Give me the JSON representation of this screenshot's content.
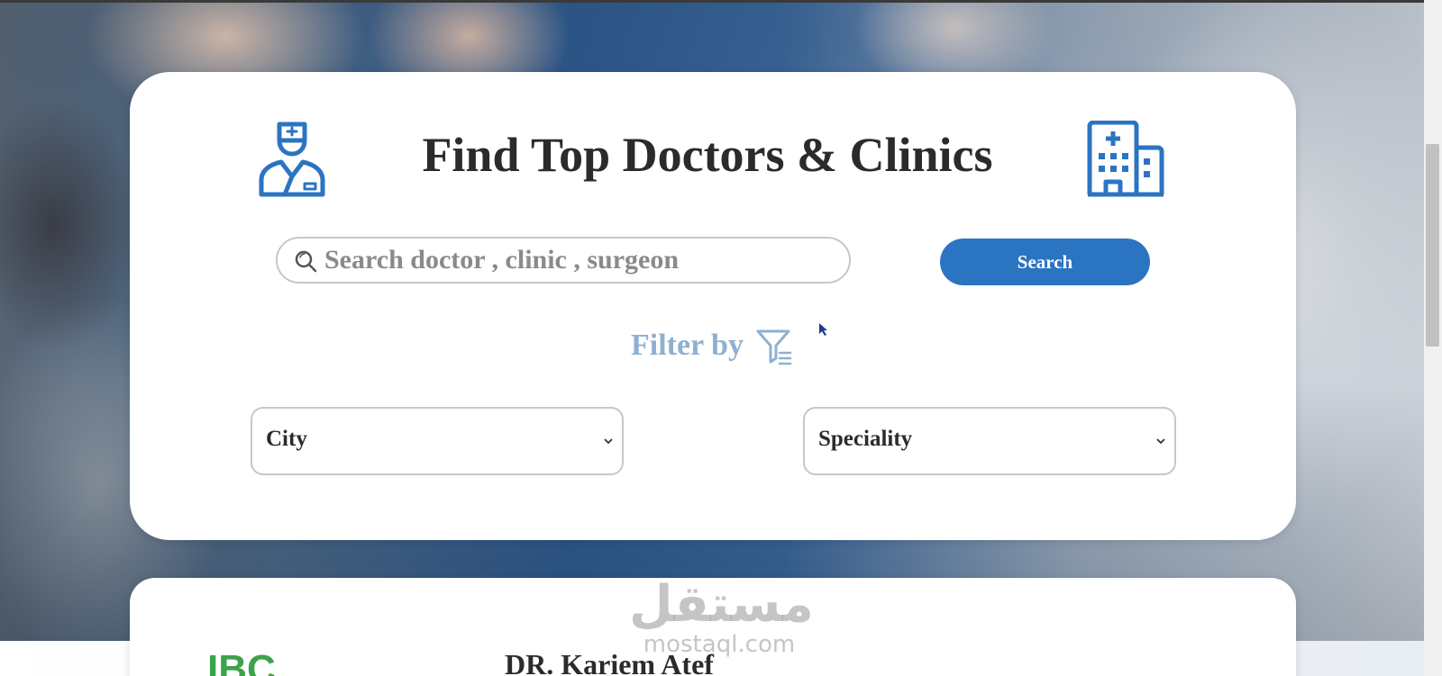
{
  "hero": {
    "title": "Find Top Doctors & Clinics",
    "icons": {
      "left": "doctor-icon",
      "right": "hospital-icon"
    }
  },
  "search": {
    "placeholder": "Search doctor , clinic , surgeon",
    "value": "",
    "button_label": "Search",
    "icon": "search-icon"
  },
  "filter": {
    "label": "Filter by",
    "icon": "filter-icon",
    "city": {
      "selected": "City"
    },
    "speciality": {
      "selected": "Speciality"
    }
  },
  "result": {
    "doctor_name": "DR. Kariem Atef",
    "logo_text": "IBC"
  },
  "watermark": {
    "arabic": "مستقل",
    "latin": "mostaql.com"
  },
  "colors": {
    "accent": "#2b74c2",
    "filter_text": "#8fb0d0",
    "title_text": "#2b2b2b",
    "logo_green": "#3da34a"
  }
}
